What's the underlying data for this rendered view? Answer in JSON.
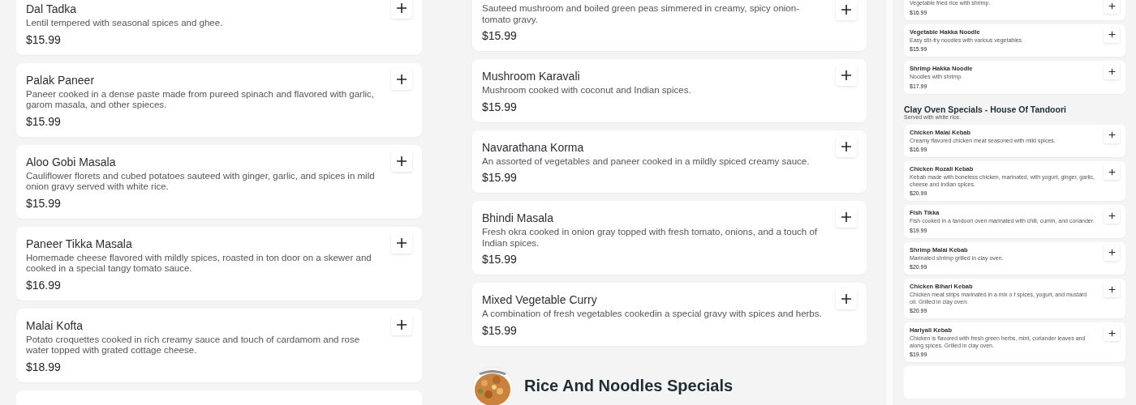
{
  "menu_columns": [
    {
      "kind": "regular",
      "more_below": true,
      "sections": [
        {
          "items": [
            {
              "name": "Dal Tadka",
              "description": "Lentil tempered with seasonal spices and ghee.",
              "price": "$15.99"
            },
            {
              "name": "Palak Paneer",
              "description": "Paneer cooked in a dense paste made from pureed spinach and flavored with garlic, garom masala, and other spieces.",
              "price": "$15.99"
            },
            {
              "name": "Aloo Gobi Masala",
              "description": "Cauliflower florets and cubed potatoes sauteed with ginger, garlic, and spices in mild onion gravy served with white rice.",
              "price": "$15.99"
            },
            {
              "name": "Paneer Tikka Masala",
              "description": "Homemade cheese flavored with mildly spices, roasted in ton door on a skewer and cooked in a special tangy tomato sauce.",
              "price": "$16.99"
            },
            {
              "name": "Malai Kofta",
              "description": "Potato croquettes cooked in rich creamy sauce and touch of cardamom and rose water topped with grated cottage cheese.",
              "price": "$18.99"
            }
          ]
        }
      ]
    },
    {
      "kind": "regular",
      "sections": [
        {
          "items": [
            {
              "description": "Sauteed mushroom and boiled green peas simmered in creamy, spicy onion-tomato gravy.",
              "price": "$15.99"
            },
            {
              "name": "Mushroom Karavali",
              "description": "Mushroom cooked with coconut and Indian spices.",
              "price": "$15.99"
            },
            {
              "name": "Navarathana Korma",
              "description": "An assorted of vegetables and paneer cooked in a mildly spiced creamy sauce.",
              "price": "$15.99"
            },
            {
              "name": "Bhindi Masala",
              "description": "Fresh okra cooked in onion gray topped with fresh tomato, onions, and a touch of Indian spices.",
              "price": "$15.99"
            },
            {
              "name": "Mixed Vegetable Curry",
              "description": "A combination of fresh vegetables cookedin a special gravy with spices and herbs.",
              "price": "$15.99"
            }
          ]
        },
        {
          "heading": "Rice And Noodles Specials"
        }
      ]
    },
    {
      "kind": "compact",
      "more_below": true,
      "sections": [
        {
          "items": [
            {
              "description": "Vegetable fried rice with shrimp.",
              "price": "$16.99"
            },
            {
              "name": "Vegetable Hakka Noodle",
              "description": "Easy stir-fry noodles with various vegetables.",
              "price": "$15.99"
            },
            {
              "name": "Shrimp Hakka Noodle",
              "description": "Noodles with shrimp.",
              "price": "$17.99"
            }
          ]
        },
        {
          "heading": "Clay Oven Specials - House Of Tandoori",
          "subheading": "Served with white rice.",
          "items": [
            {
              "name": "Chicken Malai Kebab",
              "description": "Creamy flavored chicken meat seasoned with mild spices.",
              "price": "$16.99"
            },
            {
              "name": "Chicken Rozali Kebab",
              "description": "Kebab made with boneless chicken, marinated, with yogurt, ginger, garlic, cheese and Indian spices.",
              "price": "$20.99"
            },
            {
              "name": "Fish Tikka",
              "description": "Fish cooked in a tandoori oven marinated with chili, cumin, and coriander.",
              "price": "$19.99"
            },
            {
              "name": "Shrimp Malai Kebab",
              "description": "Marinated shrimp grilled in clay oven.",
              "price": "$20.99"
            },
            {
              "name": "Chicken Bihari Kebab",
              "description": "Chicken meat strips marinated in a mix o f spices, yogurt, and mustard oil. Grilled in clay oven.",
              "price": "$20.99"
            },
            {
              "name": "Hariyali Kebab",
              "description": "Chicken is flavored with fresh green herbs, mint, coriander leaves and along spices. Grilled in clay oven.",
              "price": "$19.99"
            }
          ]
        }
      ]
    }
  ]
}
